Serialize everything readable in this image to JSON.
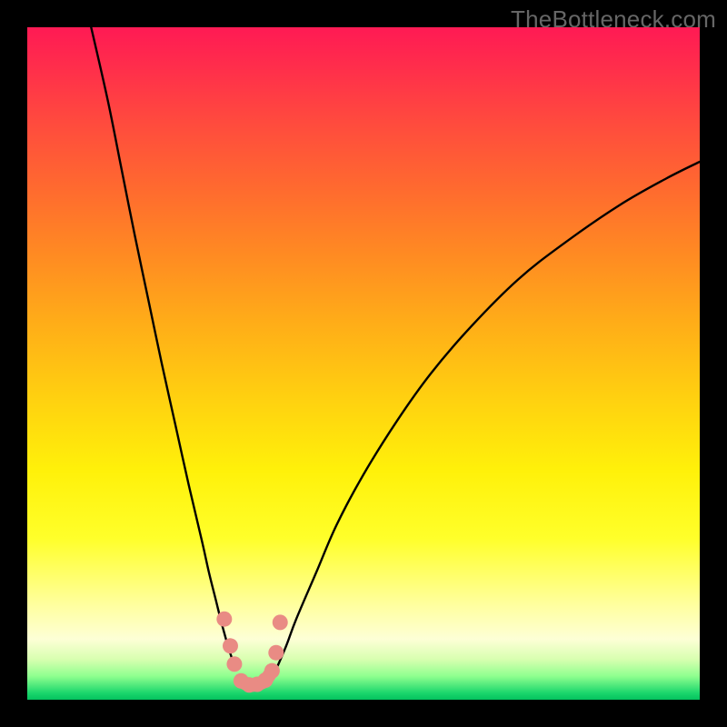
{
  "watermark": "TheBottleneck.com",
  "chart_data": {
    "type": "line",
    "title": "",
    "xlabel": "",
    "ylabel": "",
    "xlim": [
      0,
      100
    ],
    "ylim": [
      0,
      100
    ],
    "note": "V-shaped bottleneck curve over vertical red→yellow→green gradient; minimum near x≈33, y≈2. Axes and ticks not labeled in source image; values estimated from pixel positions on a 0–100 normalized grid.",
    "series": [
      {
        "name": "left-branch",
        "x": [
          9.5,
          12,
          14,
          16,
          18,
          20,
          22,
          24,
          26,
          27,
          28,
          29,
          30,
          31
        ],
        "y": [
          100,
          89,
          79,
          69,
          59.5,
          50,
          41,
          32,
          23.5,
          19,
          15,
          11,
          7.5,
          4.5
        ]
      },
      {
        "name": "right-branch",
        "x": [
          37,
          38.5,
          40,
          43,
          46,
          50,
          55,
          60,
          66,
          73,
          80,
          88,
          95,
          100
        ],
        "y": [
          4.5,
          8,
          12,
          19,
          26,
          33.5,
          41.5,
          48.5,
          55.5,
          62.5,
          68,
          73.5,
          77.5,
          80
        ]
      },
      {
        "name": "valley-markers",
        "style": "dots",
        "color": "#e98b84",
        "x": [
          29.3,
          30.2,
          30.8,
          31.8,
          33.0,
          34.2,
          35.4,
          36.4,
          37.0,
          37.6
        ],
        "y": [
          12.0,
          8.0,
          5.3,
          2.8,
          2.2,
          2.3,
          2.9,
          4.3,
          7.0,
          11.5
        ]
      }
    ]
  }
}
